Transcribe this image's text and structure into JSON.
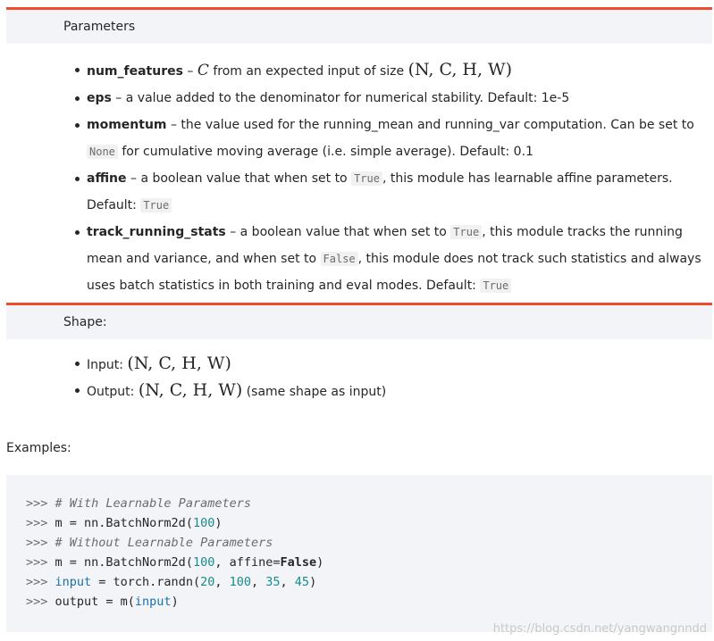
{
  "parameters_section": {
    "title": "Parameters",
    "items": [
      {
        "name": "num_features",
        "sep": " – ",
        "math": "C",
        "text_a": " from an expected input of size ",
        "math2": "(N, C, H, W)"
      },
      {
        "name": "eps",
        "sep": " – ",
        "text_a": "a value added to the denominator for numerical stability. Default: 1e-5"
      },
      {
        "name": "momentum",
        "sep": " – ",
        "text_a": "the value used for the running_mean and running_var computation. Can be set to ",
        "code1": "None",
        "text_b": " for cumulative moving average (i.e. simple average). Default: 0.1"
      },
      {
        "name": "affine",
        "sep": " – ",
        "text_a": "a boolean value that when set to ",
        "code1": "True",
        "text_b": ", this module has learnable affine parameters. Default: ",
        "code2": "True"
      },
      {
        "name": "track_running_stats",
        "sep": " – ",
        "text_a": "a boolean value that when set to ",
        "code1": "True",
        "text_b": ", this module tracks the running mean and variance, and when set to ",
        "code2": "False",
        "text_c": ", this module does not track such statistics and always uses batch statistics in both training and eval modes. Default: ",
        "code3": "True"
      }
    ]
  },
  "shape_section": {
    "title": "Shape:",
    "items": [
      {
        "label": "Input: ",
        "math": "(N, C, H, W)",
        "suffix": ""
      },
      {
        "label": "Output: ",
        "math": "(N, C, H, W)",
        "suffix": " (same shape as input)"
      }
    ]
  },
  "examples": {
    "label": "Examples:",
    "lines": [
      {
        "prompt": ">>> ",
        "comment": "# With Learnable Parameters"
      },
      {
        "prompt": ">>> ",
        "p1": "m = nn.BatchNorm2d(",
        "n1": "100",
        "p2": ")"
      },
      {
        "prompt": ">>> ",
        "comment": "# Without Learnable Parameters"
      },
      {
        "prompt": ">>> ",
        "p1": "m = nn.BatchNorm2d(",
        "n1": "100",
        "p2": ", affine=",
        "kw": "False",
        "p3": ")"
      },
      {
        "prompt": ">>> ",
        "b1": "input",
        "p1": " = torch.randn(",
        "n1": "20",
        "c1": ", ",
        "n2": "100",
        "c2": ", ",
        "n3": "35",
        "c3": ", ",
        "n4": "45",
        "p2": ")"
      },
      {
        "prompt": ">>> ",
        "p1": "output = m(",
        "b1": "input",
        "p2": ")"
      }
    ]
  },
  "watermark": "https://blog.csdn.net/yangwangnndd",
  "colors": {
    "accent": "#ee4c2c",
    "panel": "#f3f4f7",
    "code_number": "#1b8a8a",
    "code_builtin": "#1b6fa8"
  }
}
